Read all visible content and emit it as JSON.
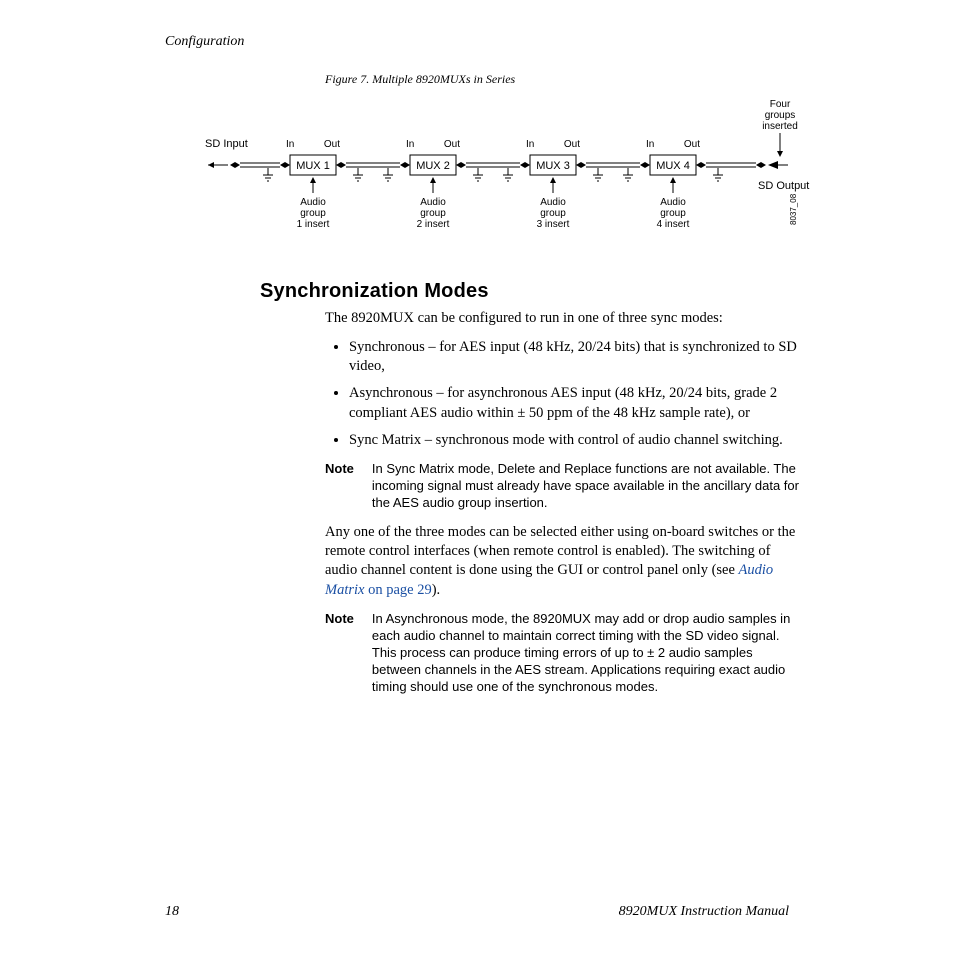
{
  "running_head": "Configuration",
  "figure": {
    "caption": "Figure 7.  Multiple 8920MUXs in Series",
    "sd_input": "SD Input",
    "sd_output": "SD Output",
    "top_label": "Four\ngroups\ninserted",
    "ref": "8037_08",
    "muxes": [
      {
        "name": "MUX 1",
        "in": "In",
        "out": "Out",
        "audio": "Audio\ngroup\n1 insert"
      },
      {
        "name": "MUX 2",
        "in": "In",
        "out": "Out",
        "audio": "Audio\ngroup\n2 insert"
      },
      {
        "name": "MUX 3",
        "in": "In",
        "out": "Out",
        "audio": "Audio\ngroup\n3 insert"
      },
      {
        "name": "MUX 4",
        "in": "In",
        "out": "Out",
        "audio": "Audio\ngroup\n4 insert"
      }
    ]
  },
  "section": {
    "heading": "Synchronization Modes",
    "intro": "The 8920MUX can be configured to run in one of three sync modes:",
    "bullets": [
      "Synchronous – for AES input (48 kHz, 20/24 bits) that is synchronized to SD video,",
      "Asynchronous – for asynchronous AES input (48 kHz, 20/24 bits, grade 2 compliant AES audio within ± 50 ppm of the 48 kHz sample rate), or",
      "Sync Matrix – synchronous mode with control of audio channel switching."
    ],
    "note1_label": "Note",
    "note1_text": "In Sync Matrix mode, Delete and Replace functions are not available. The incoming signal must already have space available in the ancillary data for the AES audio group insertion.",
    "para2_pre": "Any one of the three modes can be selected either using on-board switches or the remote control interfaces (when remote control is enabled). The switching of audio channel content is done using the GUI or control panel only (see ",
    "para2_link_ital": "Audio Matrix",
    "para2_link_plain": " on page 29",
    "para2_post": ").",
    "note2_label": "Note",
    "note2_text": "In Asynchronous mode, the 8920MUX may add or drop audio samples in each audio channel to maintain correct timing with the SD video signal. This process can produce timing errors of up to ± 2 audio samples between channels in the AES stream. Applications requiring exact audio timing should use one of the synchronous modes."
  },
  "footer": {
    "page": "18",
    "manual": "8920MUX Instruction Manual"
  }
}
